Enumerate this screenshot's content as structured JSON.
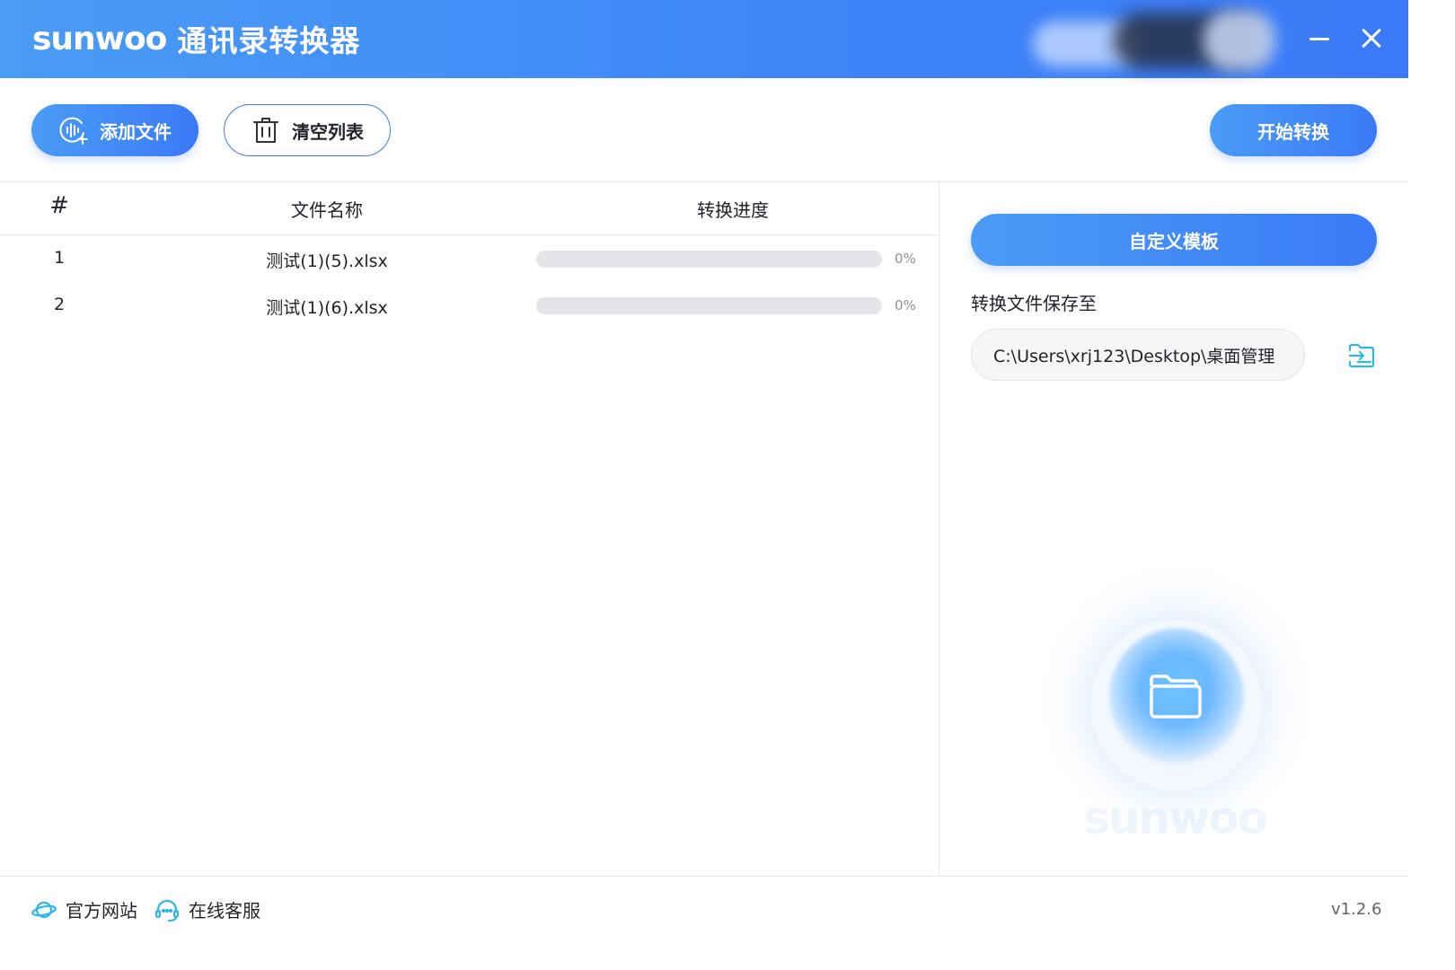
{
  "window": {
    "brand": "sunwoo",
    "app_name": "通讯录转换器"
  },
  "toolbar": {
    "add_file_label": "添加文件",
    "clear_list_label": "清空列表",
    "start_convert_label": "开始转换"
  },
  "table": {
    "columns": [
      "#",
      "文件名称",
      "转换进度"
    ],
    "rows": [
      {
        "index": "1",
        "name": "测试(1)(5).xlsx",
        "progress_text": "0%",
        "progress": 0
      },
      {
        "index": "2",
        "name": "测试(1)(6).xlsx",
        "progress_text": "0%",
        "progress": 0
      }
    ]
  },
  "panel": {
    "template_label": "自定义模板",
    "save_to_label": "转换文件保存至",
    "save_path": "C:\\Users\\xrj123\\Desktop\\桌面管理",
    "watermark": "sunwoo"
  },
  "footer": {
    "official_site": "官方网站",
    "online_service": "在线客服",
    "version": "v1.2.6"
  },
  "colors": {
    "accent": "#3b7af7",
    "accent_light": "#4a9cf6",
    "track": "#e3e5e8",
    "icon_cyan": "#2fb6e6"
  },
  "icons": {
    "add_file": "waveform-add-icon",
    "clear_list": "trash-icon",
    "change_folder": "folder-switch-icon",
    "center": "folder-icon",
    "site": "planet-icon",
    "service": "headset-icon"
  }
}
